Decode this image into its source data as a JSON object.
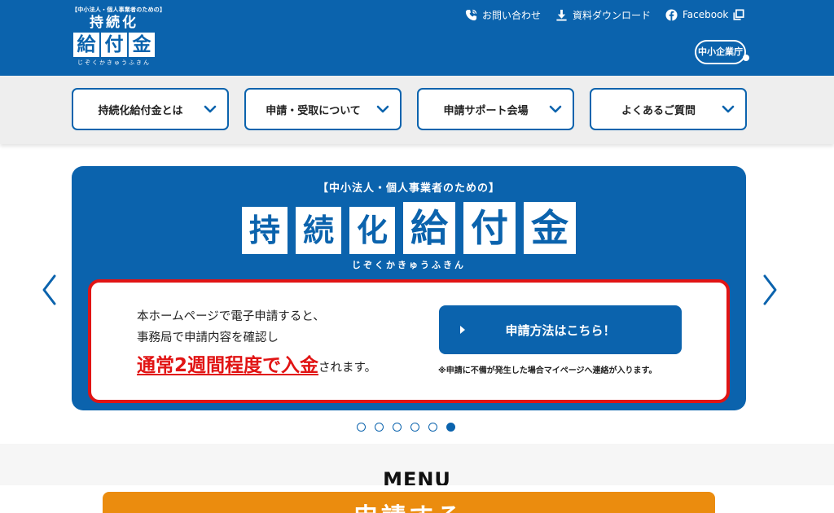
{
  "header": {
    "logo": {
      "tagline": "【中小法人・個人事業者のための】",
      "row1": "持続化",
      "row2": [
        "給",
        "付",
        "金"
      ],
      "kana": "じぞくかきゅうふきん"
    },
    "links": {
      "contact": "お問い合わせ",
      "download": "資料ダウンロード",
      "facebook": "Facebook"
    },
    "agency": "中小企業庁"
  },
  "nav": {
    "items": [
      {
        "label": "持続化給付金とは"
      },
      {
        "label": "申請・受取について"
      },
      {
        "label": "申請サポート会場"
      },
      {
        "label": "よくあるご質問"
      }
    ]
  },
  "hero": {
    "subtitle": "【中小法人・個人事業者のための】",
    "title_small": [
      "持",
      "続",
      "化"
    ],
    "title_large": [
      "給",
      "付",
      "金"
    ],
    "kana": "じぞくかきゅうふきん",
    "line1": "本ホームページで電子申請すると、",
    "line2": "事務局で申請内容を確認し",
    "highlight": "通常2週間程度で入金",
    "suffix": "されます。",
    "button": "申請方法はこちら！",
    "note": "※申請に不備が発生した場合マイページへ連絡が入ります。"
  },
  "carousel": {
    "count": 6,
    "active": 6
  },
  "menu": {
    "title": "MENU",
    "cta": "申請する"
  },
  "colors": {
    "brand": "#0b63ad",
    "alert": "#e11414",
    "cta": "#eb8c0e"
  },
  "icons": [
    "phone-icon",
    "download-icon",
    "facebook-icon",
    "external-link-icon",
    "chevron-down-icon",
    "chevron-left-icon",
    "chevron-right-icon",
    "play-arrow-icon"
  ]
}
